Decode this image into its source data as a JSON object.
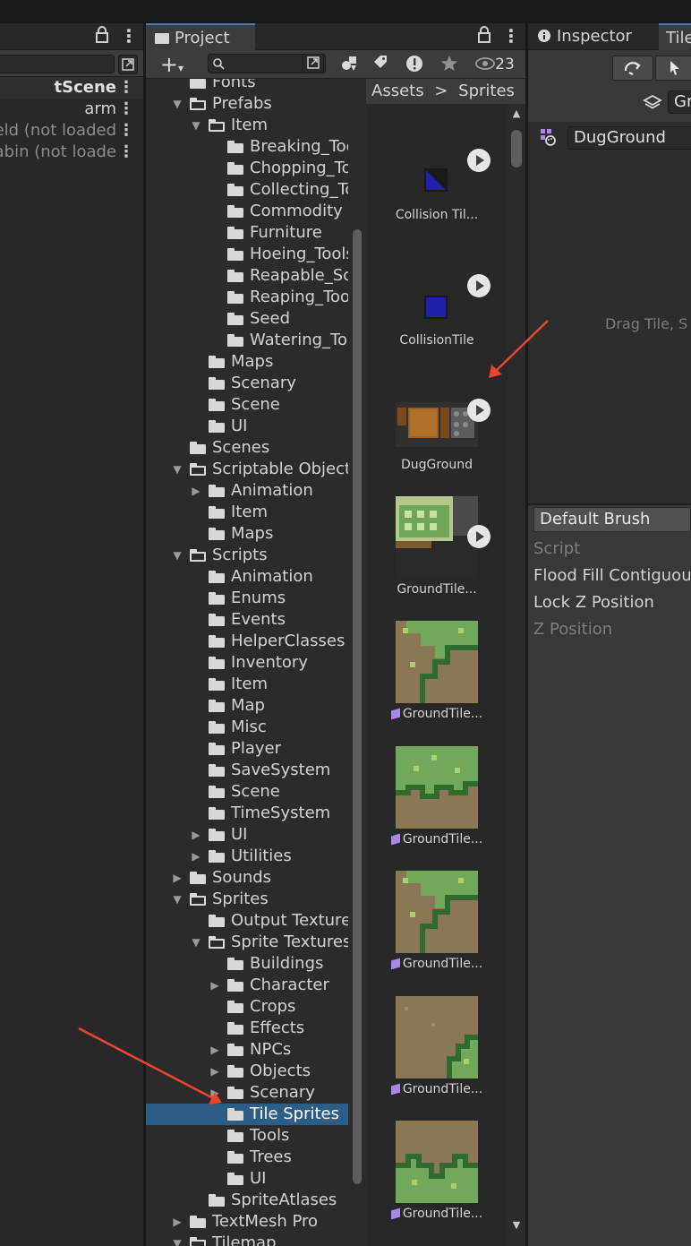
{
  "hierarchy": {
    "rows": [
      {
        "text": "tScene",
        "style": "scene"
      },
      {
        "text": "arm",
        "style": "normal"
      },
      {
        "text": "eld (not loaded",
        "style": "dim"
      },
      {
        "text": "abin (not loade",
        "style": "dim"
      }
    ],
    "more_glyph": "⋮",
    "lock_glyph": "🔒",
    "tool_icon": "scene-tools-icon"
  },
  "project": {
    "tab_label": "Project",
    "add_label": "+",
    "add_arrow": "▾",
    "search_placeholder": "",
    "count_label": "23",
    "tree_rows": [
      {
        "label": "Fonts",
        "depth": 1,
        "arrow": "",
        "open": false,
        "selected": false
      },
      {
        "label": "Prefabs",
        "depth": 1,
        "arrow": "▼",
        "open": true,
        "selected": false
      },
      {
        "label": "Item",
        "depth": 2,
        "arrow": "▼",
        "open": true,
        "selected": false
      },
      {
        "label": "Breaking_Tools",
        "depth": 3,
        "arrow": "",
        "open": false,
        "selected": false
      },
      {
        "label": "Chopping_Tools",
        "depth": 3,
        "arrow": "",
        "open": false,
        "selected": false
      },
      {
        "label": "Collecting_Tools",
        "depth": 3,
        "arrow": "",
        "open": false,
        "selected": false
      },
      {
        "label": "Commodity",
        "depth": 3,
        "arrow": "",
        "open": false,
        "selected": false
      },
      {
        "label": "Furniture",
        "depth": 3,
        "arrow": "",
        "open": false,
        "selected": false
      },
      {
        "label": "Hoeing_Tools",
        "depth": 3,
        "arrow": "",
        "open": false,
        "selected": false
      },
      {
        "label": "Reapable_Scenary",
        "depth": 3,
        "arrow": "",
        "open": false,
        "selected": false
      },
      {
        "label": "Reaping_Tools",
        "depth": 3,
        "arrow": "",
        "open": false,
        "selected": false
      },
      {
        "label": "Seed",
        "depth": 3,
        "arrow": "",
        "open": false,
        "selected": false
      },
      {
        "label": "Watering_Tools",
        "depth": 3,
        "arrow": "",
        "open": false,
        "selected": false
      },
      {
        "label": "Maps",
        "depth": 2,
        "arrow": "",
        "open": false,
        "selected": false
      },
      {
        "label": "Scenary",
        "depth": 2,
        "arrow": "",
        "open": false,
        "selected": false
      },
      {
        "label": "Scene",
        "depth": 2,
        "arrow": "",
        "open": false,
        "selected": false
      },
      {
        "label": "UI",
        "depth": 2,
        "arrow": "",
        "open": false,
        "selected": false
      },
      {
        "label": "Scenes",
        "depth": 1,
        "arrow": "",
        "open": false,
        "selected": false
      },
      {
        "label": "Scriptable Objects",
        "depth": 1,
        "arrow": "▼",
        "open": true,
        "selected": false
      },
      {
        "label": "Animation",
        "depth": 2,
        "arrow": "▶",
        "open": false,
        "selected": false
      },
      {
        "label": "Item",
        "depth": 2,
        "arrow": "",
        "open": false,
        "selected": false
      },
      {
        "label": "Maps",
        "depth": 2,
        "arrow": "",
        "open": false,
        "selected": false
      },
      {
        "label": "Scripts",
        "depth": 1,
        "arrow": "▼",
        "open": true,
        "selected": false
      },
      {
        "label": "Animation",
        "depth": 2,
        "arrow": "",
        "open": false,
        "selected": false
      },
      {
        "label": "Enums",
        "depth": 2,
        "arrow": "",
        "open": false,
        "selected": false
      },
      {
        "label": "Events",
        "depth": 2,
        "arrow": "",
        "open": false,
        "selected": false
      },
      {
        "label": "HelperClasses",
        "depth": 2,
        "arrow": "",
        "open": false,
        "selected": false
      },
      {
        "label": "Inventory",
        "depth": 2,
        "arrow": "",
        "open": false,
        "selected": false
      },
      {
        "label": "Item",
        "depth": 2,
        "arrow": "",
        "open": false,
        "selected": false
      },
      {
        "label": "Map",
        "depth": 2,
        "arrow": "",
        "open": false,
        "selected": false
      },
      {
        "label": "Misc",
        "depth": 2,
        "arrow": "",
        "open": false,
        "selected": false
      },
      {
        "label": "Player",
        "depth": 2,
        "arrow": "",
        "open": false,
        "selected": false
      },
      {
        "label": "SaveSystem",
        "depth": 2,
        "arrow": "",
        "open": false,
        "selected": false
      },
      {
        "label": "Scene",
        "depth": 2,
        "arrow": "",
        "open": false,
        "selected": false
      },
      {
        "label": "TimeSystem",
        "depth": 2,
        "arrow": "",
        "open": false,
        "selected": false
      },
      {
        "label": "UI",
        "depth": 2,
        "arrow": "▶",
        "open": false,
        "selected": false
      },
      {
        "label": "Utilities",
        "depth": 2,
        "arrow": "▶",
        "open": false,
        "selected": false
      },
      {
        "label": "Sounds",
        "depth": 1,
        "arrow": "▶",
        "open": false,
        "selected": false
      },
      {
        "label": "Sprites",
        "depth": 1,
        "arrow": "▼",
        "open": true,
        "selected": false
      },
      {
        "label": "Output Textures",
        "depth": 2,
        "arrow": "",
        "open": false,
        "selected": false
      },
      {
        "label": "Sprite Textures",
        "depth": 2,
        "arrow": "▼",
        "open": true,
        "selected": false
      },
      {
        "label": "Buildings",
        "depth": 3,
        "arrow": "",
        "open": false,
        "selected": false
      },
      {
        "label": "Character",
        "depth": 3,
        "arrow": "▶",
        "open": false,
        "selected": false
      },
      {
        "label": "Crops",
        "depth": 3,
        "arrow": "",
        "open": false,
        "selected": false
      },
      {
        "label": "Effects",
        "depth": 3,
        "arrow": "",
        "open": false,
        "selected": false
      },
      {
        "label": "NPCs",
        "depth": 3,
        "arrow": "▶",
        "open": false,
        "selected": false
      },
      {
        "label": "Objects",
        "depth": 3,
        "arrow": "▶",
        "open": false,
        "selected": false
      },
      {
        "label": "Scenary",
        "depth": 3,
        "arrow": "▶",
        "open": false,
        "selected": false
      },
      {
        "label": "Tile Sprites",
        "depth": 3,
        "arrow": "",
        "open": false,
        "selected": true
      },
      {
        "label": "Tools",
        "depth": 3,
        "arrow": "",
        "open": false,
        "selected": false
      },
      {
        "label": "Trees",
        "depth": 3,
        "arrow": "",
        "open": false,
        "selected": false
      },
      {
        "label": "UI",
        "depth": 3,
        "arrow": "",
        "open": false,
        "selected": false
      },
      {
        "label": "SpriteAtlases",
        "depth": 2,
        "arrow": "",
        "open": false,
        "selected": false
      },
      {
        "label": "TextMesh Pro",
        "depth": 1,
        "arrow": "▶",
        "open": false,
        "selected": false
      },
      {
        "label": "Tilemap",
        "depth": 1,
        "arrow": "▼",
        "open": true,
        "selected": false
      }
    ],
    "breadcrumb": [
      "Assets",
      "Sprites"
    ],
    "breadcrumb_sep": ">",
    "assets": [
      {
        "name": "Collision Til...",
        "kind": "collision-triangle",
        "has_play": true,
        "tile_badge": false
      },
      {
        "name": "CollisionTile",
        "kind": "collision-square",
        "has_play": true,
        "tile_badge": false
      },
      {
        "name": "DugGround",
        "kind": "dug",
        "has_play": true,
        "tile_badge": false
      },
      {
        "name": "GroundTile...",
        "kind": "palette",
        "has_play": true,
        "tile_badge": false
      },
      {
        "name": "GroundTile...",
        "kind": "grass-corner",
        "has_play": false,
        "tile_badge": true
      },
      {
        "name": "GroundTile...",
        "kind": "grass-top",
        "has_play": false,
        "tile_badge": true
      },
      {
        "name": "GroundTile...",
        "kind": "grass-corner",
        "has_play": false,
        "tile_badge": true
      },
      {
        "name": "GroundTile...",
        "kind": "dirt-corner",
        "has_play": false,
        "tile_badge": true
      },
      {
        "name": "GroundTile...",
        "kind": "dirt-bottom",
        "has_play": false,
        "tile_badge": true
      }
    ]
  },
  "inspector": {
    "tab_label": "Inspector",
    "tab2_label": "Tile",
    "layer_value": "Gr",
    "palette_value": "DugGround",
    "drag_hint": "Drag Tile, S",
    "brush_value": "Default Brush",
    "props": [
      {
        "label": "Script",
        "dim": true
      },
      {
        "label": "Flood Fill Contiguous",
        "dim": false
      },
      {
        "label": "Lock Z Position",
        "dim": false
      },
      {
        "label": "Z Position",
        "dim": true
      }
    ]
  },
  "colors": {
    "selection": "#2c5d87",
    "annotation_arrow": "#e8452f",
    "tile_badge": "#a887e8"
  }
}
